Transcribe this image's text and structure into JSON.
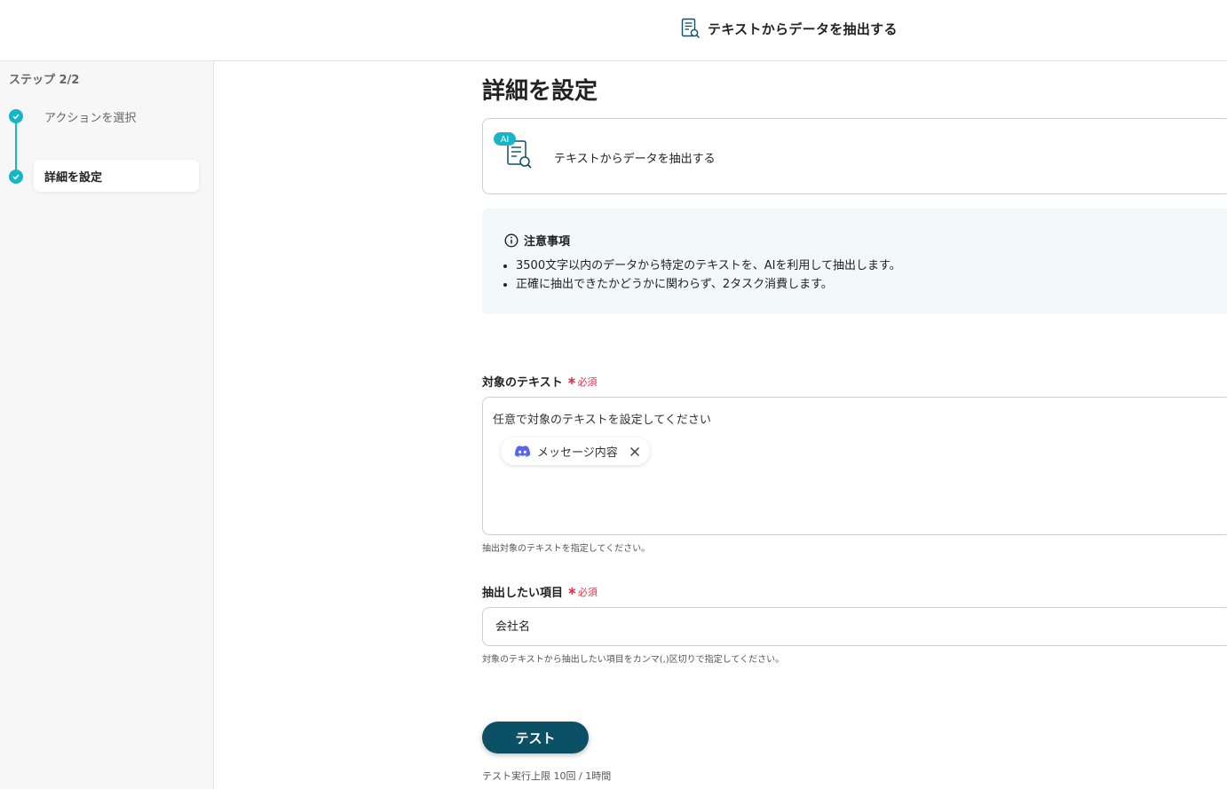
{
  "header": {
    "title": "テキストからデータを抽出する",
    "icon": "document-search-icon"
  },
  "sidebar": {
    "step_count": "ステップ 2/2",
    "steps": [
      {
        "label": "アクションを選択",
        "status": "done"
      },
      {
        "label": "詳細を設定",
        "status": "current"
      }
    ]
  },
  "main": {
    "title": "詳細を設定",
    "action_card": {
      "badge": "AI",
      "label": "テキストからデータを抽出する"
    },
    "notice": {
      "heading": "注意事項",
      "items": [
        "3500文字以内のデータから特定のテキストを、AIを利用して抽出します。",
        "正確に抽出できたかどうかに関わらず、2タスク消費します。"
      ]
    },
    "target_text": {
      "label": "対象のテキスト",
      "required": "必須",
      "placeholder": "任意で対象のテキストを設定してください",
      "chip": "メッセージ内容",
      "helper": "抽出対象のテキストを指定してください。"
    },
    "extract_items": {
      "label": "抽出したい項目",
      "required": "必須",
      "value": "会社名",
      "helper": "対象のテキストから抽出したい項目をカンマ(,)区切りで指定してください。"
    },
    "test_button": "テスト",
    "test_limit": "テスト実行上限 10回 / 1時間"
  },
  "colors": {
    "accent": "#16b6c8",
    "primary_button": "#0c5066",
    "required": "#e0334c",
    "notice_bg": "#f1f8f7"
  }
}
